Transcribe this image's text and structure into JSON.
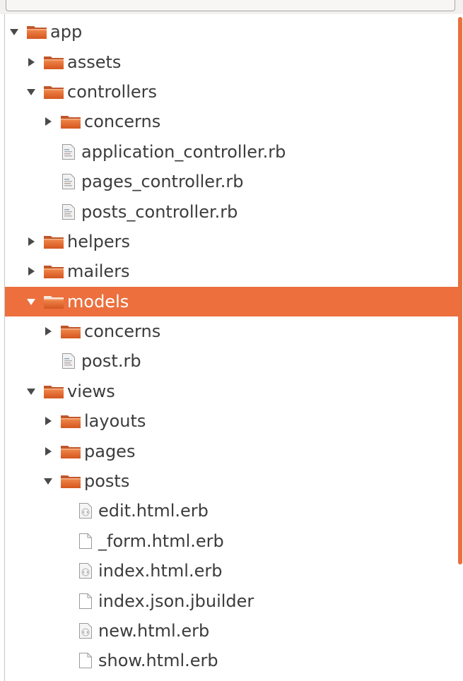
{
  "accent_color": "#ec6f3d",
  "tree": [
    {
      "name": "app",
      "type": "folder",
      "expanded": true,
      "level": 0
    },
    {
      "name": "assets",
      "type": "folder",
      "expanded": false,
      "level": 1
    },
    {
      "name": "controllers",
      "type": "folder",
      "expanded": true,
      "level": 1
    },
    {
      "name": "concerns",
      "type": "folder",
      "expanded": false,
      "level": 2
    },
    {
      "name": "application_controller.rb",
      "type": "file-rb",
      "level": 2
    },
    {
      "name": "pages_controller.rb",
      "type": "file-rb",
      "level": 2
    },
    {
      "name": "posts_controller.rb",
      "type": "file-rb",
      "level": 2
    },
    {
      "name": "helpers",
      "type": "folder",
      "expanded": false,
      "level": 1
    },
    {
      "name": "mailers",
      "type": "folder",
      "expanded": false,
      "level": 1
    },
    {
      "name": "models",
      "type": "folder",
      "expanded": true,
      "level": 1,
      "selected": true
    },
    {
      "name": "concerns",
      "type": "folder",
      "expanded": false,
      "level": 2
    },
    {
      "name": "post.rb",
      "type": "file-rb",
      "level": 2
    },
    {
      "name": "views",
      "type": "folder",
      "expanded": true,
      "level": 1
    },
    {
      "name": "layouts",
      "type": "folder",
      "expanded": false,
      "level": 2
    },
    {
      "name": "pages",
      "type": "folder",
      "expanded": false,
      "level": 2
    },
    {
      "name": "posts",
      "type": "folder",
      "expanded": true,
      "level": 2
    },
    {
      "name": "edit.html.erb",
      "type": "file-html",
      "level": 3
    },
    {
      "name": "_form.html.erb",
      "type": "file-plain",
      "level": 3
    },
    {
      "name": "index.html.erb",
      "type": "file-html",
      "level": 3
    },
    {
      "name": "index.json.jbuilder",
      "type": "file-plain",
      "level": 3
    },
    {
      "name": "new.html.erb",
      "type": "file-html",
      "level": 3
    },
    {
      "name": "show.html.erb",
      "type": "file-plain",
      "level": 3
    }
  ]
}
